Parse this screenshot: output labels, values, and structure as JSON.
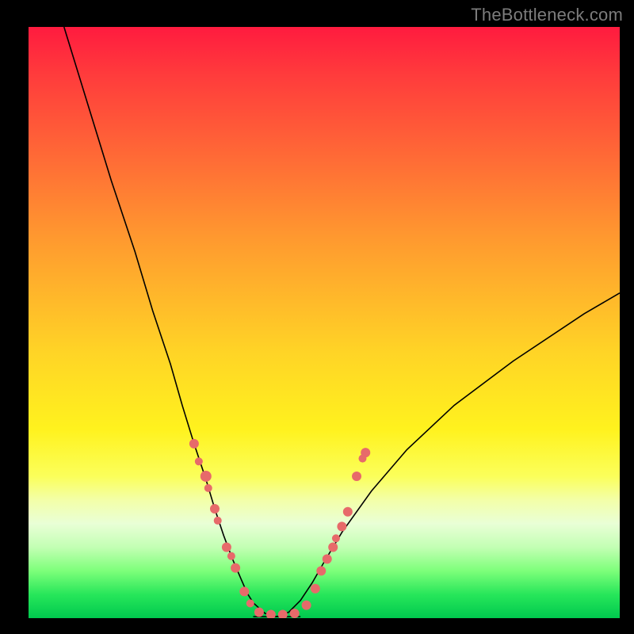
{
  "watermark": "TheBottleneck.com",
  "colors": {
    "frame": "#000000",
    "gradient_top": "#ff1b3f",
    "gradient_mid": "#fff21e",
    "gradient_bottom": "#00c94e",
    "curve": "#000000",
    "marker": "#e76a6a"
  },
  "chart_data": {
    "type": "line",
    "title": "",
    "xlabel": "",
    "ylabel": "",
    "xlim": [
      0,
      100
    ],
    "ylim": [
      0,
      100
    ],
    "grid": false,
    "legend": false,
    "annotations": [],
    "series": [
      {
        "name": "curve-left",
        "x": [
          6,
          10,
          14,
          18,
          21,
          24,
          26,
          28,
          30,
          31.5,
          33,
          34.5,
          36,
          37,
          38,
          40,
          42
        ],
        "values": [
          100,
          87,
          74,
          62,
          52,
          43,
          36,
          29.5,
          23.5,
          18.5,
          14,
          10,
          6.5,
          4.2,
          2.6,
          0.8,
          0.25
        ]
      },
      {
        "name": "curve-right",
        "x": [
          42,
          44,
          46,
          48,
          50,
          53,
          58,
          64,
          72,
          82,
          94,
          100
        ],
        "values": [
          0.25,
          1.0,
          3.0,
          6.0,
          9.5,
          14.5,
          21.5,
          28.5,
          36,
          43.5,
          51.5,
          55
        ]
      },
      {
        "name": "flat-bottom",
        "x": [
          38,
          40,
          42,
          44,
          46
        ],
        "values": [
          0.25,
          0.25,
          0.25,
          0.25,
          0.25
        ]
      }
    ],
    "markers": [
      {
        "x": 28.0,
        "y": 29.5,
        "r": 6
      },
      {
        "x": 28.8,
        "y": 26.5,
        "r": 5
      },
      {
        "x": 30.0,
        "y": 24.0,
        "r": 7
      },
      {
        "x": 30.4,
        "y": 22.0,
        "r": 5
      },
      {
        "x": 31.5,
        "y": 18.5,
        "r": 6
      },
      {
        "x": 32.0,
        "y": 16.5,
        "r": 5
      },
      {
        "x": 33.5,
        "y": 12.0,
        "r": 6
      },
      {
        "x": 34.3,
        "y": 10.5,
        "r": 5
      },
      {
        "x": 35.0,
        "y": 8.5,
        "r": 6
      },
      {
        "x": 36.5,
        "y": 4.5,
        "r": 6
      },
      {
        "x": 37.5,
        "y": 2.5,
        "r": 5
      },
      {
        "x": 39.0,
        "y": 1.0,
        "r": 6
      },
      {
        "x": 41.0,
        "y": 0.6,
        "r": 6
      },
      {
        "x": 43.0,
        "y": 0.6,
        "r": 6
      },
      {
        "x": 45.0,
        "y": 0.8,
        "r": 6
      },
      {
        "x": 47.0,
        "y": 2.2,
        "r": 6
      },
      {
        "x": 48.5,
        "y": 5.0,
        "r": 6
      },
      {
        "x": 49.5,
        "y": 8.0,
        "r": 6
      },
      {
        "x": 50.5,
        "y": 10.0,
        "r": 6
      },
      {
        "x": 51.5,
        "y": 12.0,
        "r": 6
      },
      {
        "x": 52.0,
        "y": 13.5,
        "r": 5
      },
      {
        "x": 53.0,
        "y": 15.5,
        "r": 6
      },
      {
        "x": 54.0,
        "y": 18.0,
        "r": 6
      },
      {
        "x": 55.5,
        "y": 24.0,
        "r": 6
      },
      {
        "x": 56.5,
        "y": 27.0,
        "r": 5
      },
      {
        "x": 57.0,
        "y": 28.0,
        "r": 6
      }
    ]
  }
}
